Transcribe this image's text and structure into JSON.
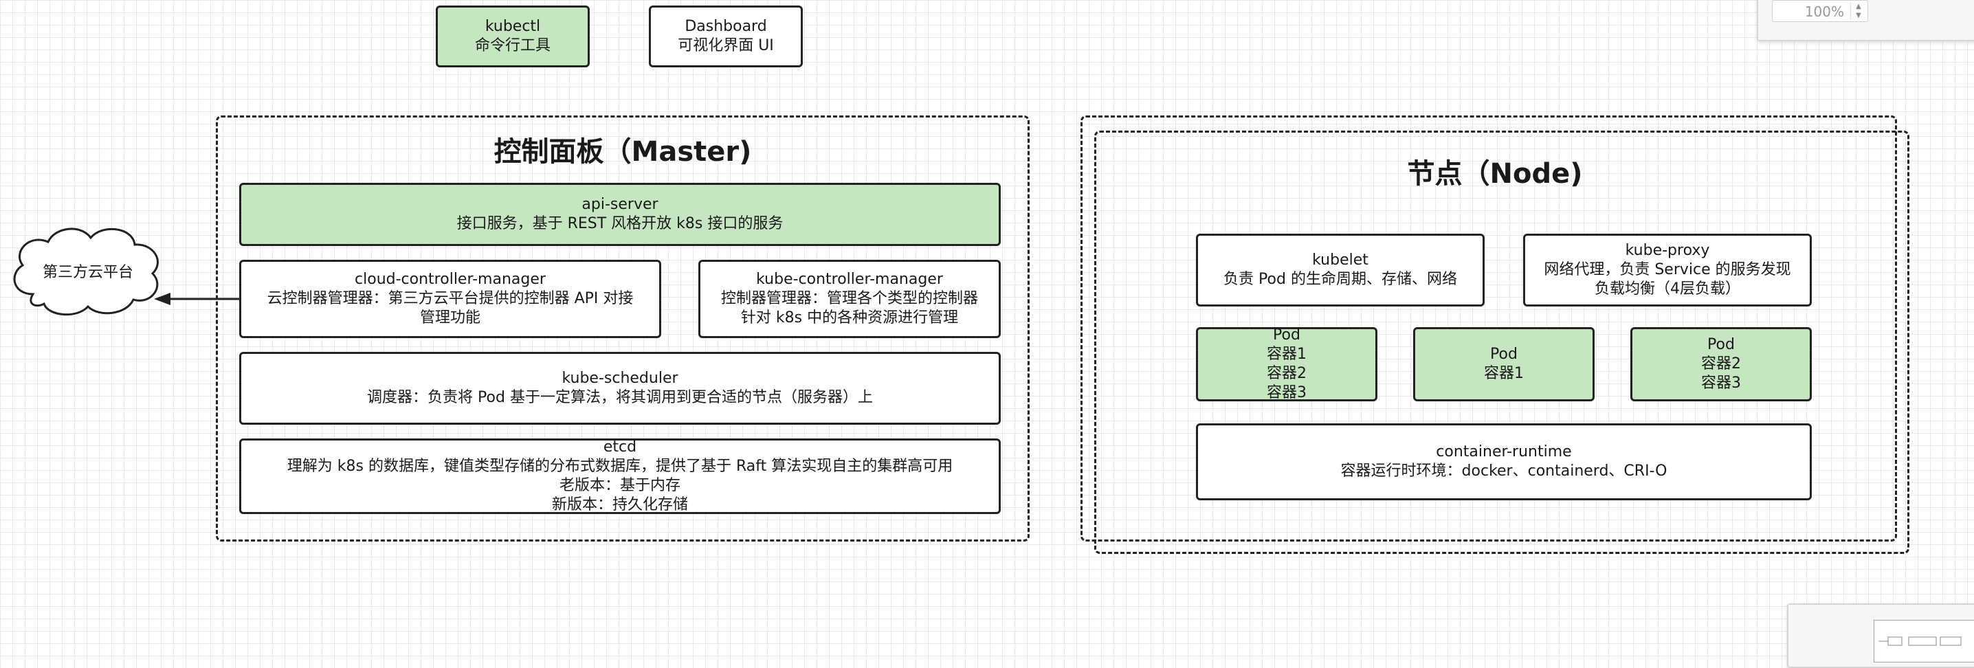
{
  "tools": {
    "kubectl": {
      "line1": "kubectl",
      "line2": "命令行工具"
    },
    "dashboard": {
      "line1": "Dashboard",
      "line2": "可视化界面 UI"
    }
  },
  "master": {
    "title": "控制面板（Master)",
    "api_server": {
      "name": "api-server",
      "desc": "接口服务，基于 REST 风格开放 k8s 接口的服务"
    },
    "cloud_controller_manager": {
      "name": "cloud-controller-manager",
      "desc1": "云控制器管理器：第三方云平台提供的控制器 API 对接",
      "desc2": "管理功能"
    },
    "kube_controller_manager": {
      "name": "kube-controller-manager",
      "desc1": "控制器管理器：管理各个类型的控制器",
      "desc2": "针对 k8s 中的各种资源进行管理"
    },
    "kube_scheduler": {
      "name": "kube-scheduler",
      "desc": "调度器：负责将 Pod 基于一定算法，将其调用到更合适的节点（服务器）上"
    },
    "etcd": {
      "name": "etcd",
      "desc1": "理解为 k8s 的数据库，键值类型存储的分布式数据库，提供了基于 Raft 算法实现自主的集群高可用",
      "old": "老版本：基于内存",
      "new": "新版本：持久化存储"
    }
  },
  "cloud": {
    "label": "第三方云平台"
  },
  "node": {
    "title": "节点（Node)",
    "kubelet": {
      "name": "kubelet",
      "desc": "负责 Pod 的生命周期、存储、网络"
    },
    "kube_proxy": {
      "name": "kube-proxy",
      "desc1": "网络代理，负责 Service 的服务发现",
      "desc2": "负载均衡（4层负载）"
    },
    "pods": [
      {
        "name": "Pod",
        "containers": [
          "容器1",
          "容器2",
          "容器3"
        ]
      },
      {
        "name": "Pod",
        "containers": [
          "容器1"
        ]
      },
      {
        "name": "Pod",
        "containers": [
          "容器2",
          "容器3"
        ]
      }
    ],
    "runtime": {
      "name": "container-runtime",
      "desc": "容器运行时环境：docker、containerd、CRI-O"
    }
  },
  "zoom": {
    "value": "100%"
  },
  "colors": {
    "green_fill": "#c6e6c2",
    "stroke": "#222222"
  }
}
